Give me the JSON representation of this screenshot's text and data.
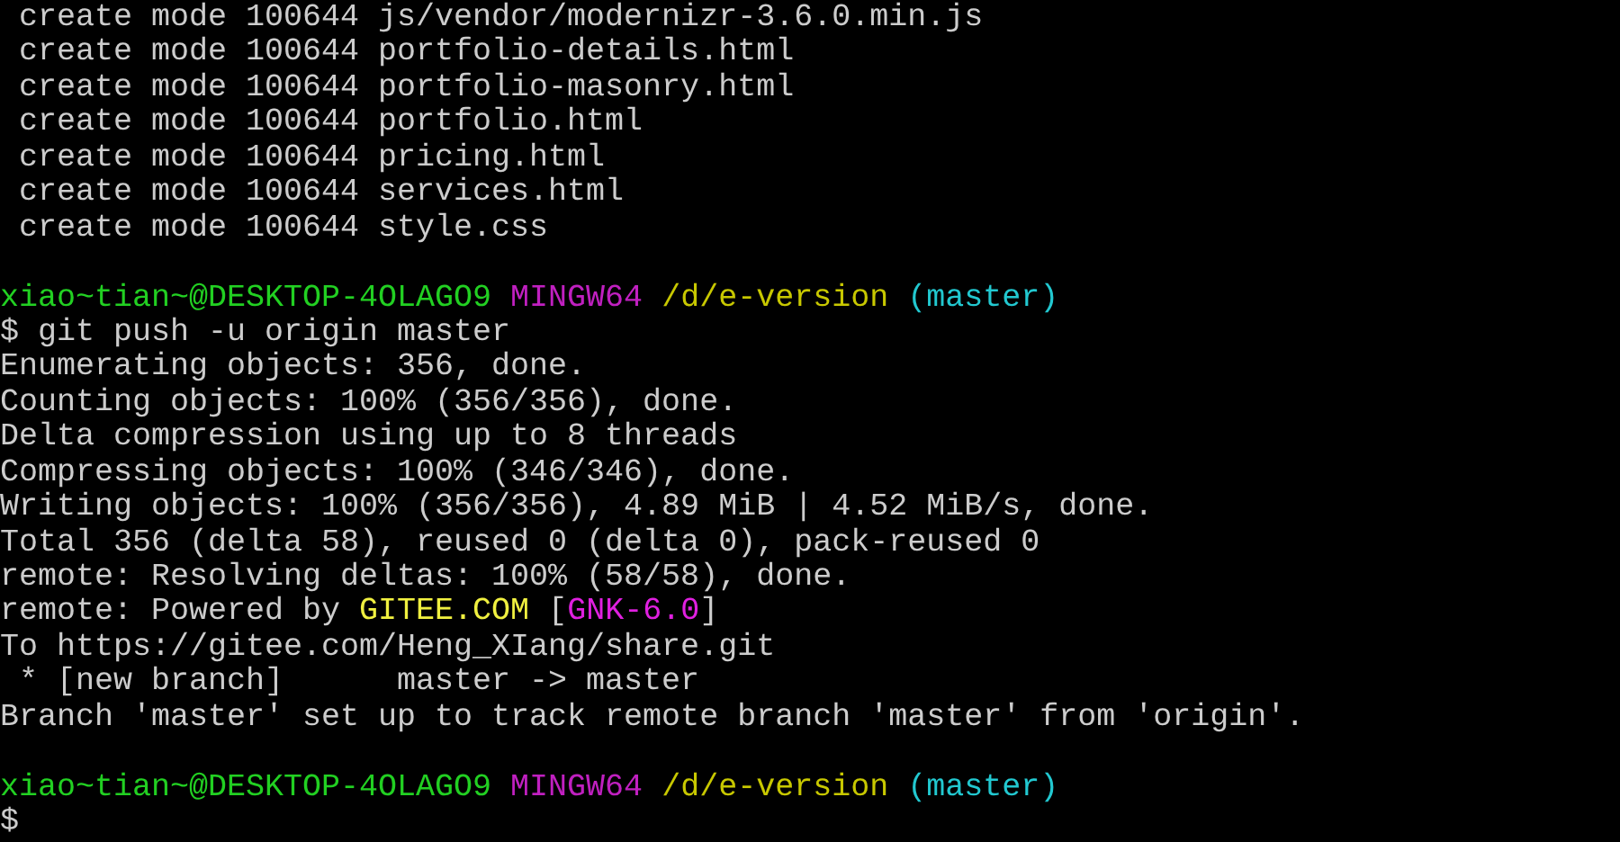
{
  "terminal": {
    "lines": [
      {
        "kind": "text",
        "segments": [
          {
            "text": " create mode 100644 js/vendor/modernizr-3.6.0.min.js",
            "color": "#cccccc"
          }
        ]
      },
      {
        "kind": "text",
        "segments": [
          {
            "text": " create mode 100644 portfolio-details.html",
            "color": "#cccccc"
          }
        ]
      },
      {
        "kind": "text",
        "segments": [
          {
            "text": " create mode 100644 portfolio-masonry.html",
            "color": "#cccccc"
          }
        ]
      },
      {
        "kind": "text",
        "segments": [
          {
            "text": " create mode 100644 portfolio.html",
            "color": "#cccccc"
          }
        ]
      },
      {
        "kind": "text",
        "segments": [
          {
            "text": " create mode 100644 pricing.html",
            "color": "#cccccc"
          }
        ]
      },
      {
        "kind": "text",
        "segments": [
          {
            "text": " create mode 100644 services.html",
            "color": "#cccccc"
          }
        ]
      },
      {
        "kind": "text",
        "segments": [
          {
            "text": " create mode 100644 style.css",
            "color": "#cccccc"
          }
        ]
      },
      {
        "kind": "blank"
      },
      {
        "kind": "text",
        "segments": [
          {
            "text": "xiao~tian~@DESKTOP-4OLAGO9",
            "color": "#22d022"
          },
          {
            "text": "MINGW64",
            "color": "#c020c0"
          },
          {
            "text": "/d/e-version",
            "color": "#c8c800"
          },
          {
            "text": "(master)",
            "color": "#22c8d0"
          }
        ]
      },
      {
        "kind": "text",
        "segments": [
          {
            "text": "$ git push -u origin master",
            "color": "#cccccc"
          }
        ]
      },
      {
        "kind": "text",
        "segments": [
          {
            "text": "Enumerating objects: 356, done.",
            "color": "#cccccc"
          }
        ]
      },
      {
        "kind": "text",
        "segments": [
          {
            "text": "Counting objects: 100% (356/356), done.",
            "color": "#cccccc"
          }
        ]
      },
      {
        "kind": "text",
        "segments": [
          {
            "text": "Delta compression using up to 8 threads",
            "color": "#cccccc"
          }
        ]
      },
      {
        "kind": "text",
        "segments": [
          {
            "text": "Compressing objects: 100% (346/346), done.",
            "color": "#cccccc"
          }
        ]
      },
      {
        "kind": "text",
        "segments": [
          {
            "text": "Writing objects: 100% (356/356), 4.89 MiB | 4.52 MiB/s, done.",
            "color": "#cccccc"
          }
        ]
      },
      {
        "kind": "text",
        "segments": [
          {
            "text": "Total 356 (delta 58), reused 0 (delta 0), pack-reused 0",
            "color": "#cccccc"
          }
        ]
      },
      {
        "kind": "text",
        "segments": [
          {
            "text": "remote: Resolving deltas: 100% (58/58), done.",
            "color": "#cccccc"
          }
        ]
      },
      {
        "kind": "text",
        "segments": [
          {
            "text": "remote: Powered by",
            "color": "#cccccc"
          },
          {
            "text": "GITEE.COM",
            "color": "#f0f040"
          },
          {
            "text": "[",
            "color": "#cccccc"
          },
          {
            "text": "GNK-6.0",
            "color": "#e020e0"
          },
          {
            "text": "]",
            "color": "#cccccc"
          }
        ]
      },
      {
        "kind": "text",
        "segments": [
          {
            "text": "To https://gitee.com/Heng_XIang/share.git",
            "color": "#cccccc"
          }
        ]
      },
      {
        "kind": "text",
        "segments": [
          {
            "text": " * [new branch]      master -> master",
            "color": "#cccccc"
          }
        ]
      },
      {
        "kind": "text",
        "segments": [
          {
            "text": "Branch 'master' set up to track remote branch 'master' from 'origin'.",
            "color": "#cccccc"
          }
        ]
      },
      {
        "kind": "blank"
      },
      {
        "kind": "text",
        "segments": [
          {
            "text": "xiao~tian~@DESKTOP-4OLAGO9",
            "color": "#22d022"
          },
          {
            "text": "MINGW64",
            "color": "#c020c0"
          },
          {
            "text": "/d/e-version",
            "color": "#c8c800"
          },
          {
            "text": "(master)",
            "color": "#22c8d0"
          }
        ]
      },
      {
        "kind": "text",
        "segments": [
          {
            "text": "$",
            "color": "#cccccc"
          }
        ]
      }
    ]
  }
}
